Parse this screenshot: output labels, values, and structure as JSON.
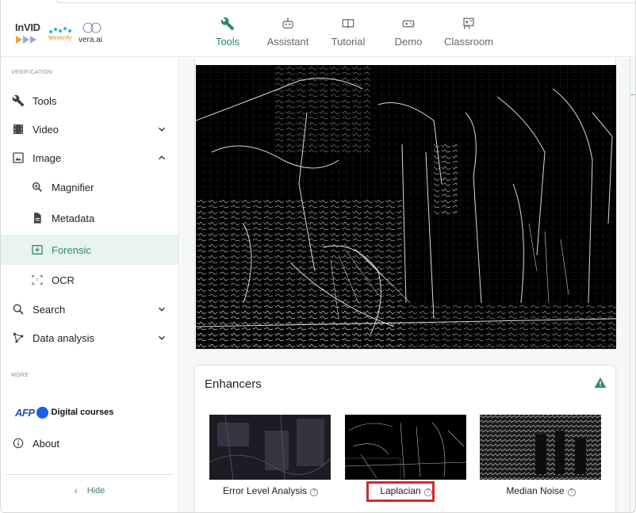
{
  "brand": {
    "invid": "InVID",
    "weverify": "WeVerify",
    "vera": "vera.ai"
  },
  "nav": [
    {
      "label": "Tools",
      "icon": "wrench-icon",
      "active": true
    },
    {
      "label": "Assistant",
      "icon": "robot-icon",
      "active": false
    },
    {
      "label": "Tutorial",
      "icon": "book-icon",
      "active": false
    },
    {
      "label": "Demo",
      "icon": "gamepad-icon",
      "active": false
    },
    {
      "label": "Classroom",
      "icon": "classroom-icon",
      "active": false
    }
  ],
  "sidebar": {
    "section_verification": "VERIFICATION",
    "items": [
      {
        "label": "Tools",
        "icon": "wrench-icon"
      },
      {
        "label": "Video",
        "icon": "film-icon",
        "chevron": "down"
      },
      {
        "label": "Image",
        "icon": "image-icon",
        "chevron": "up"
      },
      {
        "label": "Magnifier",
        "icon": "zoom-icon",
        "sub": true
      },
      {
        "label": "Metadata",
        "icon": "document-icon",
        "sub": true
      },
      {
        "label": "Forensic",
        "icon": "forensic-icon",
        "sub": true,
        "active": true
      },
      {
        "label": "OCR",
        "icon": "ocr-icon",
        "sub": true
      },
      {
        "label": "Search",
        "icon": "search-icon",
        "chevron": "down"
      },
      {
        "label": "Data analysis",
        "icon": "graph-icon",
        "chevron": "down"
      }
    ],
    "section_more": "MORE",
    "afp": {
      "logo": "AFP",
      "label": "Digital courses"
    },
    "about": "About",
    "hide": "Hide"
  },
  "main": {
    "enhancers_title": "Enhancers",
    "thumbnails": [
      {
        "label": "Error Level Analysis"
      },
      {
        "label": "Laplacian",
        "selected": true
      },
      {
        "label": "Median Noise"
      }
    ]
  },
  "colors": {
    "accent": "#2e8b6e",
    "active_bg": "#e8f3ef",
    "selection": "#d9262c",
    "warning": "#2e8b6e"
  }
}
